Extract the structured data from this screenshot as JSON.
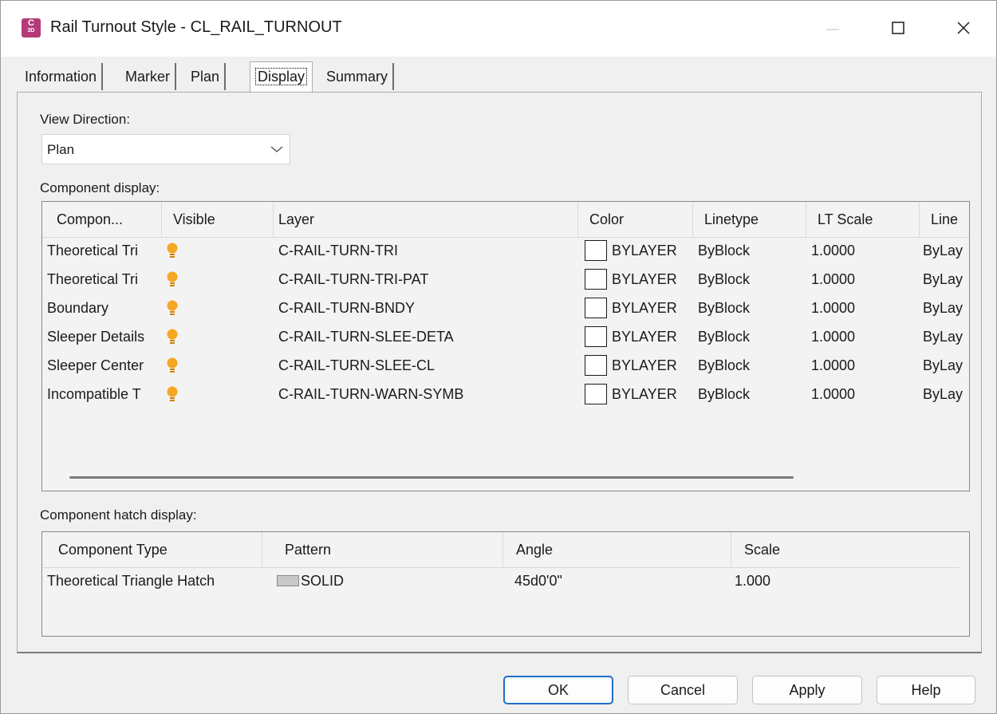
{
  "window": {
    "title": "Rail Turnout Style - CL_RAIL_TURNOUT",
    "app_icon_text": "C",
    "app_icon_subtext": "3D"
  },
  "tabs": [
    {
      "label": "Information"
    },
    {
      "label": "Marker"
    },
    {
      "label": "Plan"
    },
    {
      "label": "Display",
      "active": true
    },
    {
      "label": "Summary"
    }
  ],
  "view_direction": {
    "label": "View Direction:",
    "value": "Plan"
  },
  "component_display": {
    "label": "Component display:",
    "columns": [
      "Compon...",
      "Visible",
      "Layer",
      "Color",
      "Linetype",
      "LT Scale",
      "Line"
    ],
    "rows": [
      {
        "component": "Theoretical Tri",
        "layer": "C-RAIL-TURN-TRI",
        "color": "BYLAYER",
        "linetype": "ByBlock",
        "lt_scale": "1.0000",
        "lineweight": "ByLay"
      },
      {
        "component": "Theoretical Tri",
        "layer": "C-RAIL-TURN-TRI-PAT",
        "color": "BYLAYER",
        "linetype": "ByBlock",
        "lt_scale": "1.0000",
        "lineweight": "ByLay"
      },
      {
        "component": "Boundary",
        "layer": "C-RAIL-TURN-BNDY",
        "color": "BYLAYER",
        "linetype": "ByBlock",
        "lt_scale": "1.0000",
        "lineweight": "ByLay"
      },
      {
        "component": "Sleeper Details",
        "layer": "C-RAIL-TURN-SLEE-DETA",
        "color": "BYLAYER",
        "linetype": "ByBlock",
        "lt_scale": "1.0000",
        "lineweight": "ByLay"
      },
      {
        "component": "Sleeper Center",
        "layer": "C-RAIL-TURN-SLEE-CL",
        "color": "BYLAYER",
        "linetype": "ByBlock",
        "lt_scale": "1.0000",
        "lineweight": "ByLay"
      },
      {
        "component": "Incompatible T",
        "layer": "C-RAIL-TURN-WARN-SYMB",
        "color": "BYLAYER",
        "linetype": "ByBlock",
        "lt_scale": "1.0000",
        "lineweight": "ByLay"
      }
    ]
  },
  "component_hatch_display": {
    "label": "Component hatch display:",
    "columns": [
      "Component Type",
      "Pattern",
      "Angle",
      "Scale"
    ],
    "rows": [
      {
        "component_type": "Theoretical Triangle Hatch",
        "pattern": "SOLID",
        "angle": "45d0'0\"",
        "scale": "1.000"
      }
    ]
  },
  "buttons": {
    "ok": "OK",
    "cancel": "Cancel",
    "apply": "Apply",
    "help": "Help"
  },
  "colors": {
    "bulb_on": "#f5a623",
    "primary_button_border": "#1f6fc4",
    "app_icon": "#b43a78"
  }
}
